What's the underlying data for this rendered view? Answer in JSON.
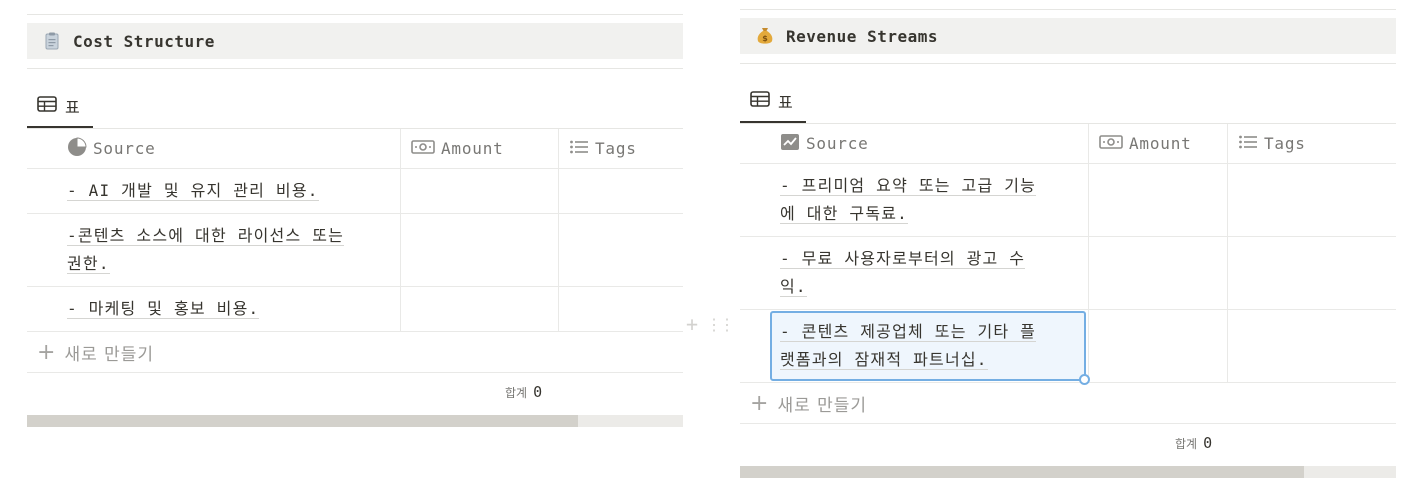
{
  "cost": {
    "title": "Cost Structure",
    "icon": "clipboard-icon",
    "view_tab": "표",
    "columns": {
      "source": "Source",
      "amount": "Amount",
      "tags": "Tags"
    },
    "rows": [
      {
        "line1": "- AI 개발 및 유지 관리 비용.",
        "line2": ""
      },
      {
        "line1": "-콘텐츠 소스에 대한 라이선스 또는",
        "line2": "권한."
      },
      {
        "line1": "- 마케팅 및 홍보 비용.",
        "line2": ""
      }
    ],
    "new_label": "새로 만들기",
    "sum_label": "합계",
    "sum_value": "0",
    "scroll_fraction": 0.84
  },
  "revenue": {
    "title": "Revenue Streams",
    "icon": "money-bag-icon",
    "view_tab": "표",
    "columns": {
      "source": "Source",
      "amount": "Amount",
      "tags": "Tags"
    },
    "rows": [
      {
        "line1": "- 프리미엄 요약 또는 고급 기능",
        "line2": "에 대한 구독료."
      },
      {
        "line1": "- 무료 사용자로부터의 광고 수",
        "line2": "익."
      },
      {
        "line1": "- 콘텐츠 제공업체 또는 기타 플",
        "line2": "랫폼과의 잠재적 파트너십.",
        "selected": true
      }
    ],
    "new_label": "새로 만들기",
    "sum_label": "합계",
    "sum_value": "0",
    "scroll_fraction": 0.86
  },
  "colors": {
    "accent_selection": "#74aee3",
    "title_bg": "#f1f1ef",
    "text": "#37352f",
    "muted": "#787774"
  }
}
